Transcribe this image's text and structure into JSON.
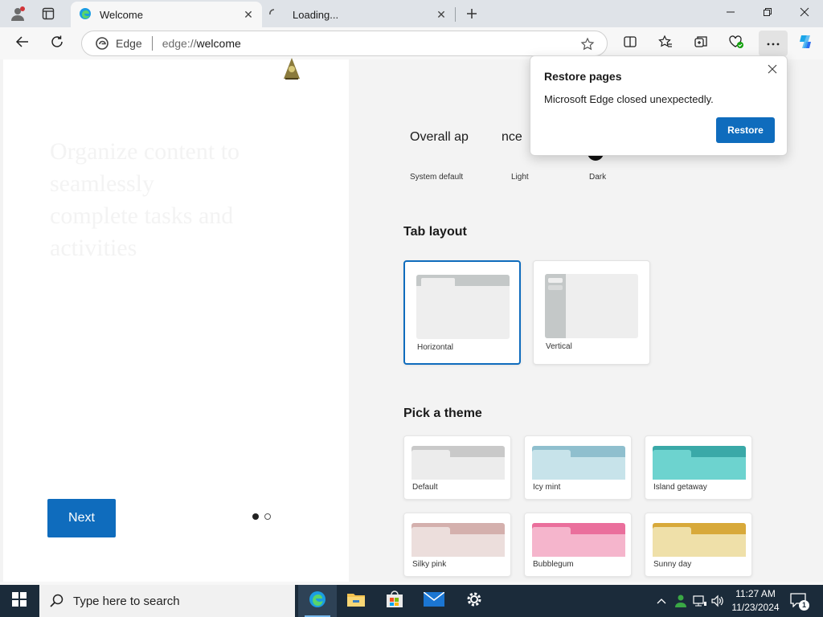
{
  "browser": {
    "tabs": [
      {
        "title": "Welcome",
        "icon": "edge-icon",
        "active": true
      },
      {
        "title": "Loading...",
        "icon": "loading-spinner-icon",
        "active": false
      }
    ],
    "address_bar": {
      "site_label": "Edge",
      "url_scheme": "edge://",
      "url_path": "welcome"
    },
    "toolbar_icons": [
      "back-icon",
      "refresh-icon",
      "favorite-star-icon",
      "split-screen-icon",
      "favorites-icon",
      "collections-icon",
      "browser-essentials-icon",
      "more-icon",
      "copilot-icon"
    ],
    "window_controls": [
      "minimize-icon",
      "restore-icon",
      "close-icon"
    ]
  },
  "welcome_left": {
    "next_label": "Next",
    "title_faint": "Organize content to seamlessly complete tasks and activities",
    "pagination": {
      "current": 1,
      "total": 2
    }
  },
  "appearance": {
    "title_part1": "Overall ap",
    "title_part2": "nce",
    "options": [
      "System default",
      "Light",
      "Dark"
    ]
  },
  "tab_layout": {
    "title": "Tab layout",
    "options": [
      {
        "label": "Horizontal",
        "selected": true
      },
      {
        "label": "Vertical",
        "selected": false
      }
    ]
  },
  "themes": {
    "title": "Pick a theme",
    "items": [
      {
        "label": "Default",
        "top": "#c9c9c9",
        "body": "#ececec"
      },
      {
        "label": "Icy mint",
        "top": "#8fbfce",
        "body": "#c7e3ea"
      },
      {
        "label": "Island getaway",
        "top": "#3aa9a8",
        "body": "#6dd3cf"
      },
      {
        "label": "Silky pink",
        "top": "#d4b0ad",
        "body": "#ecdedc"
      },
      {
        "label": "Bubblegum",
        "top": "#ea6f9c",
        "body": "#f5b5cc"
      },
      {
        "label": "Sunny day",
        "top": "#d8a93a",
        "body": "#efe0a9"
      }
    ]
  },
  "restore_popup": {
    "title": "Restore pages",
    "message": "Microsoft Edge closed unexpectedly.",
    "button": "Restore"
  },
  "taskbar": {
    "search_placeholder": "Type here to search",
    "apps": [
      "edge-icon",
      "file-explorer-icon",
      "store-icon",
      "mail-icon",
      "settings-icon"
    ],
    "time": "11:27 AM",
    "date": "11/23/2024",
    "notification_count": "1"
  },
  "colors": {
    "accent": "#0f6cbd",
    "taskbar": "#1b2b3a"
  }
}
